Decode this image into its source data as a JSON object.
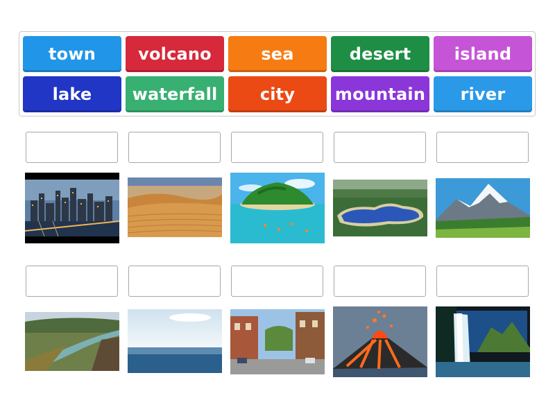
{
  "word_bank": {
    "tiles": [
      {
        "label": "town",
        "color": "#2196e8"
      },
      {
        "label": "volcano",
        "color": "#d6293c"
      },
      {
        "label": "sea",
        "color": "#f77b13"
      },
      {
        "label": "desert",
        "color": "#1f8e45"
      },
      {
        "label": "island",
        "color": "#c555d6"
      },
      {
        "label": "lake",
        "color": "#2136c5"
      },
      {
        "label": "waterfall",
        "color": "#38b071"
      },
      {
        "label": "city",
        "color": "#ec4a14"
      },
      {
        "label": "mountain",
        "color": "#8a36d9"
      },
      {
        "label": "river",
        "color": "#2a9ae8"
      }
    ]
  },
  "matching": {
    "images": [
      {
        "name": "city-skyline-image",
        "icon": "city-at-night"
      },
      {
        "name": "desert-dunes-image",
        "icon": "sand-dunes"
      },
      {
        "name": "tropical-island-image",
        "icon": "island"
      },
      {
        "name": "lake-image",
        "icon": "lake"
      },
      {
        "name": "mountain-image",
        "icon": "snowy-mountain"
      },
      {
        "name": "river-valley-image",
        "icon": "river"
      },
      {
        "name": "open-sea-image",
        "icon": "sea"
      },
      {
        "name": "town-street-image",
        "icon": "town-street"
      },
      {
        "name": "erupting-volcano-image",
        "icon": "volcano"
      },
      {
        "name": "waterfall-image",
        "icon": "waterfall"
      }
    ]
  }
}
